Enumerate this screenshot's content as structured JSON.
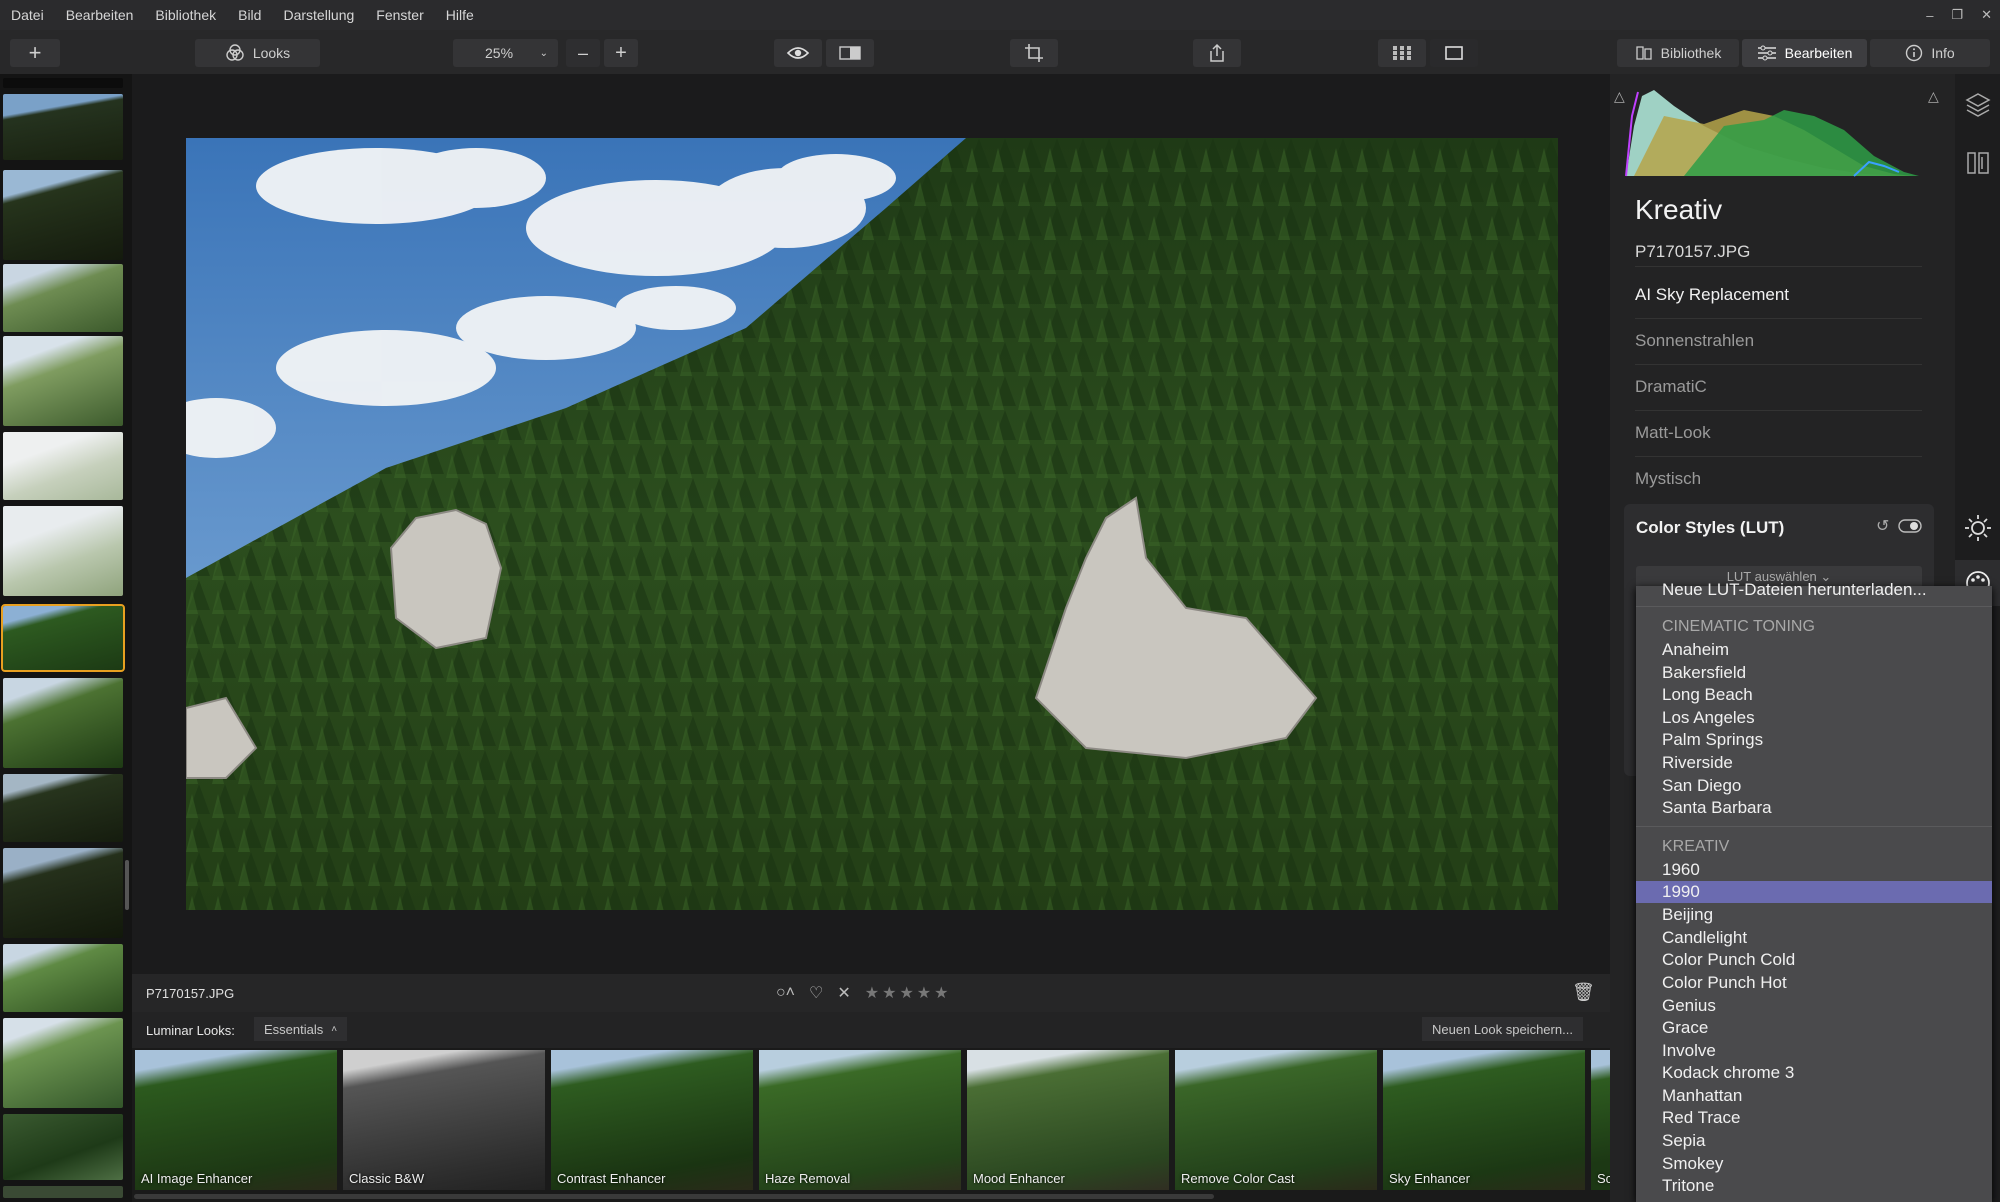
{
  "menu": [
    "Datei",
    "Bearbeiten",
    "Bibliothek",
    "Bild",
    "Darstellung",
    "Fenster",
    "Hilfe"
  ],
  "window_controls": [
    "–",
    "❐",
    "✕"
  ],
  "toolbar": {
    "add_label": "+",
    "looks_label": "Looks",
    "zoom_value": "25%",
    "zoom_minus": "–",
    "zoom_plus": "+",
    "bibliothek_label": "Bibliothek",
    "bearbeiten_label": "Bearbeiten",
    "info_label": "Info"
  },
  "image": {
    "filename": "P7170157.JPG"
  },
  "rating": {
    "stars": 0,
    "max": 5
  },
  "looks": {
    "label": "Luminar Looks:",
    "category": "Essentials",
    "save_button": "Neuen Look speichern...",
    "items": [
      "AI Image Enhancer",
      "Classic B&W",
      "Contrast Enhancer",
      "Haze Removal",
      "Mood Enhancer",
      "Remove Color Cast",
      "Sky Enhancer",
      "Sc"
    ]
  },
  "panel": {
    "title": "Kreativ",
    "filename": "P7170157.JPG",
    "tools": [
      "AI Sky Replacement",
      "Sonnenstrahlen",
      "DramatiC",
      "Matt-Look",
      "Mystisch"
    ],
    "color_styles_title": "Color Styles (LUT)",
    "lut_select": "LUT auswählen ⌄"
  },
  "lut_dropdown": {
    "download_item": "Neue LUT-Dateien herunterladen...",
    "groups": [
      {
        "header": "CINEMATIC TONING",
        "items": [
          "Anaheim",
          "Bakersfield",
          "Long Beach",
          "Los Angeles",
          "Palm Springs",
          "Riverside",
          "San Diego",
          "Santa Barbara"
        ]
      },
      {
        "header": "KREATIV",
        "items": [
          "1960",
          "1990",
          "Beijing",
          "Candlelight",
          "Color Punch Cold",
          "Color Punch Hot",
          "Genius",
          "Grace",
          "Involve",
          "Kodack chrome  3",
          "Manhattan",
          "Red Trace",
          "Sepia",
          "Smokey",
          "Tritone"
        ]
      }
    ],
    "selected": "1990"
  },
  "colors": {
    "accent_selection": "#6b6bb0",
    "thumb_selected_border": "#e8a020",
    "histogram_green": "#2e9e46",
    "histogram_yellow": "#b5a54a"
  }
}
